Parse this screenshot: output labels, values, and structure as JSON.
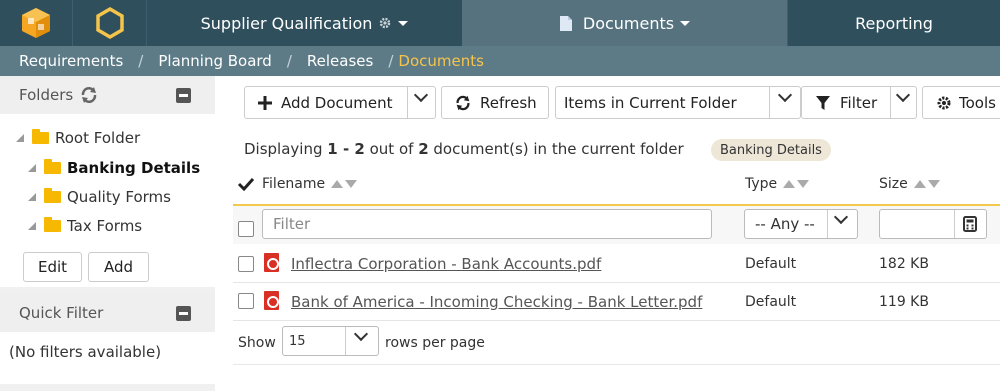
{
  "nav": {
    "product": "Supplier Qualification",
    "documents": "Documents",
    "reporting": "Reporting"
  },
  "breadcrumb": [
    "Requirements",
    "Planning Board",
    "Releases",
    "Documents"
  ],
  "sidebar": {
    "folders_title": "Folders",
    "tree": [
      "Root Folder",
      "Banking Details",
      "Quality Forms",
      "Tax Forms"
    ],
    "edit_label": "Edit",
    "add_label": "Add",
    "quick_filter_title": "Quick Filter",
    "no_filters": "(No filters available)"
  },
  "toolbar": {
    "add_document": "Add Document",
    "refresh": "Refresh",
    "scope": "Items in Current Folder",
    "filter": "Filter",
    "tools": "Tools"
  },
  "summary": {
    "prefix": "Displaying",
    "range": "1 - 2",
    "middle": "out of",
    "total": "2",
    "suffix": "document(s) in the current folder",
    "badge": "Banking Details"
  },
  "columns": {
    "filename": "Filename",
    "type": "Type",
    "size": "Size"
  },
  "filters": {
    "filename_placeholder": "Filter",
    "type_value": "-- Any --"
  },
  "rows": [
    {
      "filename": "Inflectra Corporation - Bank Accounts.pdf",
      "type": "Default",
      "size": "182 KB"
    },
    {
      "filename": "Bank of America - Incoming Checking - Bank Letter.pdf",
      "type": "Default",
      "size": "119 KB"
    }
  ],
  "paging": {
    "show_label": "Show",
    "page_size": "15",
    "rows_label": "rows per page"
  },
  "colors": {
    "topbar": "#2f4f5d",
    "active_nav": "#55727e",
    "breadcrumb_bar": "#5d7b87",
    "active_crumb": "#f5c44a",
    "accent_line": "#f2c94c"
  }
}
